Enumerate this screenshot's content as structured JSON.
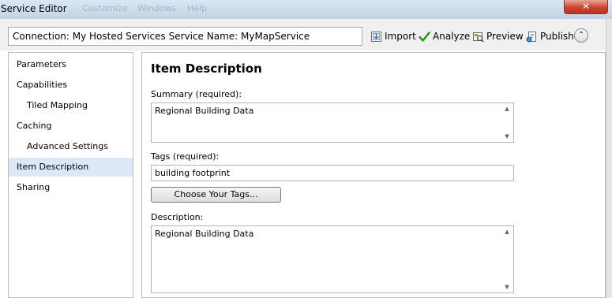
{
  "window": {
    "title": "Service Editor",
    "ghost_menu": [
      "Customize",
      "Windows",
      "Help"
    ],
    "close_glyph": "✕"
  },
  "toolbar": {
    "connection": "Connection: My Hosted Services   Service Name: MyMapService",
    "import_label": "Import",
    "analyze_label": "Analyze",
    "preview_label": "Preview",
    "publish_label": "Publish",
    "collapse_glyph": "⌃",
    "icons": [
      "import-icon",
      "checkmark-icon",
      "preview-icon",
      "publish-icon",
      "chevron-up-icon"
    ]
  },
  "sidebar": {
    "items": [
      {
        "label": "Parameters",
        "sub": false,
        "selected": false
      },
      {
        "label": "Capabilities",
        "sub": false,
        "selected": false
      },
      {
        "label": "Tiled Mapping",
        "sub": true,
        "selected": false
      },
      {
        "label": "Caching",
        "sub": false,
        "selected": false
      },
      {
        "label": "Advanced Settings",
        "sub": true,
        "selected": false
      },
      {
        "label": "Item Description",
        "sub": false,
        "selected": true
      },
      {
        "label": "Sharing",
        "sub": false,
        "selected": false
      }
    ]
  },
  "main": {
    "heading": "Item Description",
    "summary_label": "Summary (required):",
    "summary_value": "Regional Building Data",
    "tags_label": "Tags (required):",
    "tags_value": "building footprint",
    "choose_tags_label": "Choose Your Tags...",
    "description_label": "Description:",
    "description_value": "Regional Building Data"
  },
  "colors": {
    "selection": "#dce8f5",
    "analyze_check": "#2e8b1e",
    "close_button": "#c9452f"
  }
}
